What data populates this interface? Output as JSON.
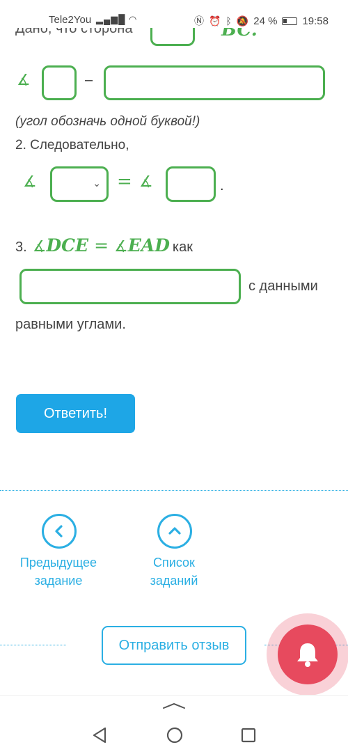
{
  "status_bar": {
    "carrier": "Tele2You",
    "battery": "24 %",
    "time": "19:58"
  },
  "task": {
    "cut_line_text": "Дано, что сторона",
    "cut_side": "BC.",
    "row1_dash": "–",
    "hint": "(угол обозначь одной буквой!)",
    "step2": "2. Следовательно,",
    "row2_dot": ".",
    "step3_number": "3.",
    "step3_lhs": "DCE",
    "step3_rhs": "EAD",
    "step3_kak": "как",
    "row3_after": "с данными",
    "row3_line2": "равными углами."
  },
  "answer_button": "Ответить!",
  "nav": {
    "prev_label": "Предыдущее задание",
    "list_label": "Список заданий"
  },
  "feedback_button": "Отправить отзыв",
  "colors": {
    "green": "#4caf50",
    "blue": "#1ea6e6",
    "bell": "#e74a5e"
  },
  "icons": {
    "angle": "∡",
    "prev": "chevron-left-icon",
    "list": "chevron-up-icon",
    "bell": "bell-icon"
  }
}
